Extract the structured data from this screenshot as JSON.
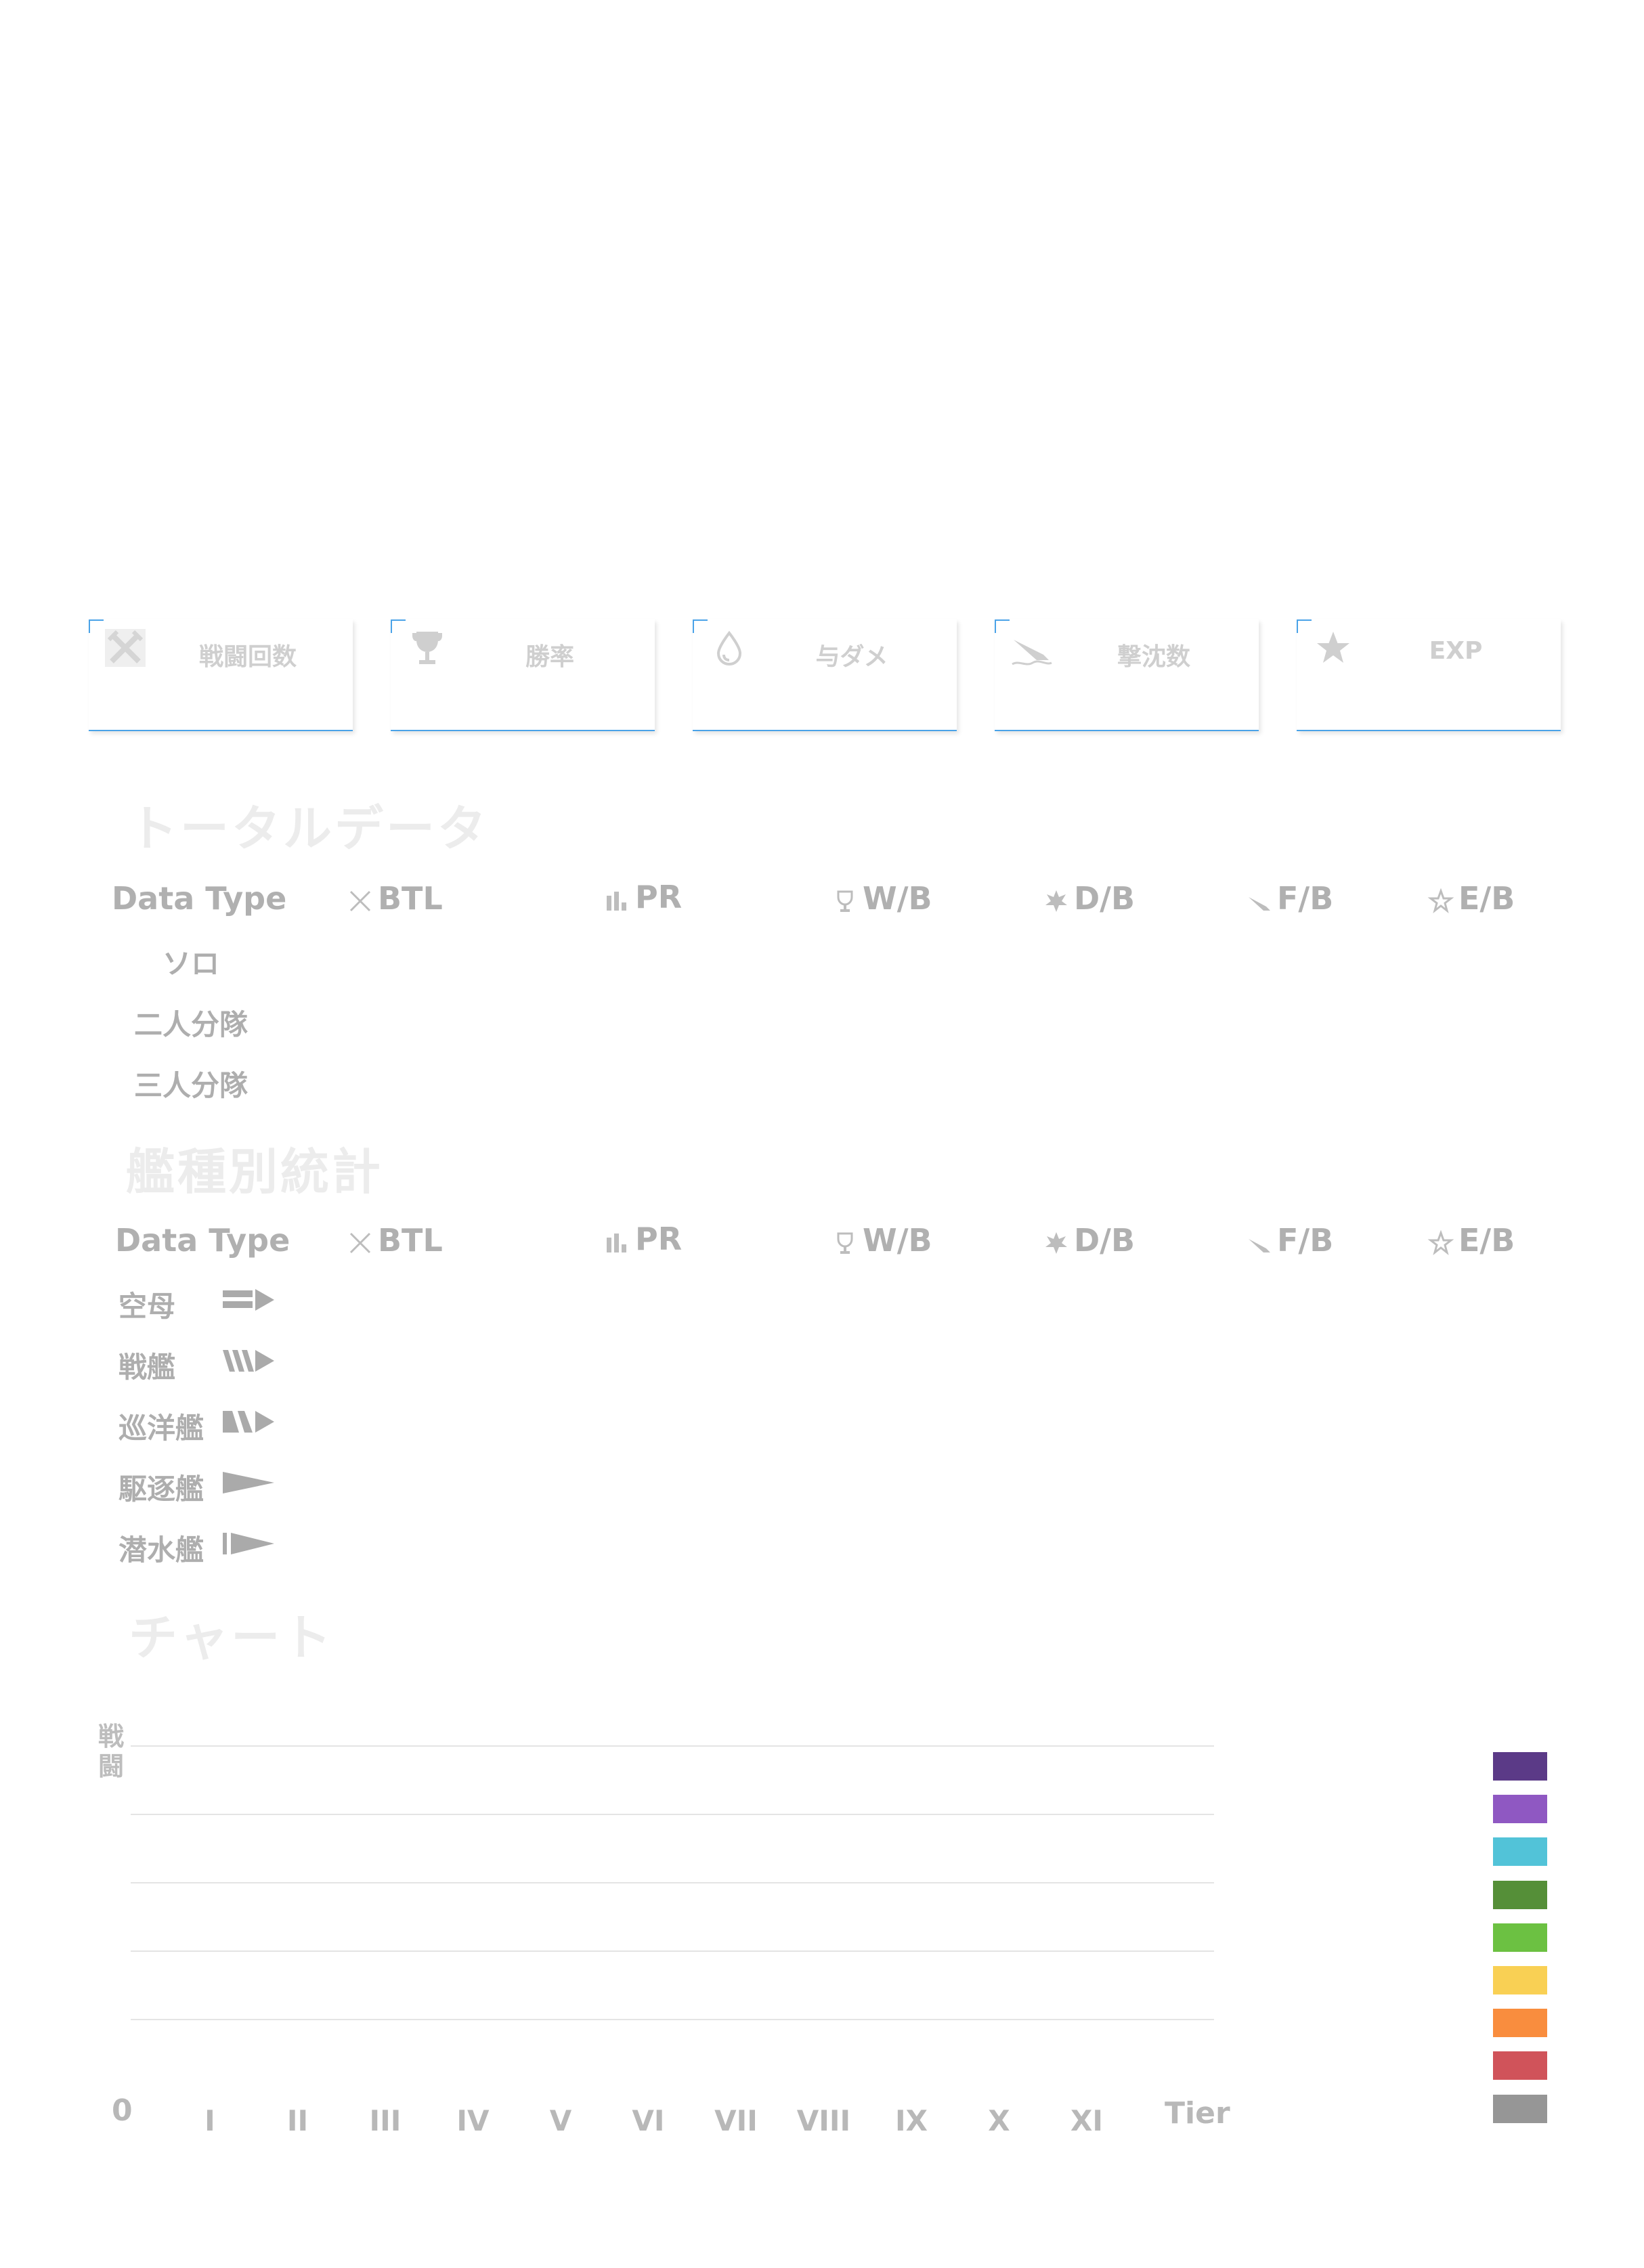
{
  "stat_cards": [
    {
      "label": "戦闘回数",
      "icon": "crossed-swords-icon"
    },
    {
      "label": "勝率",
      "icon": "trophy-icon"
    },
    {
      "label": "与ダメ",
      "icon": "droplet-icon"
    },
    {
      "label": "撃沈数",
      "icon": "sinking-ship-icon"
    },
    {
      "label": "EXP",
      "icon": "star-icon"
    }
  ],
  "total_section": {
    "title": "トータルデータ",
    "headers": [
      "Data Type",
      "BTL",
      "PR",
      "W/B",
      "D/B",
      "F/B",
      "E/B"
    ],
    "rows": [
      "ソロ",
      "二人分隊",
      "三人分隊"
    ]
  },
  "ship_section": {
    "title": "艦種別統計",
    "headers": [
      "Data Type",
      "BTL",
      "PR",
      "W/B",
      "D/B",
      "F/B",
      "E/B"
    ],
    "rows": [
      {
        "label": "空母",
        "icon": "carrier-icon"
      },
      {
        "label": "戦艦",
        "icon": "battleship-icon"
      },
      {
        "label": "巡洋艦",
        "icon": "cruiser-icon"
      },
      {
        "label": "駆逐艦",
        "icon": "destroyer-icon"
      },
      {
        "label": "潜水艦",
        "icon": "submarine-icon"
      }
    ]
  },
  "chart_section": {
    "title": "チャート",
    "chart_data": {
      "type": "bar",
      "ylabel": "戦闘",
      "xlabel": "Tier",
      "y_zero_label": "0",
      "categories": [
        "I",
        "II",
        "III",
        "IV",
        "V",
        "VI",
        "VII",
        "VIII",
        "IX",
        "X",
        "XI"
      ],
      "series": [],
      "legend_colors": [
        "#5b3a87",
        "#8f58c2",
        "#52c3d8",
        "#558f38",
        "#6cc142",
        "#f9d054",
        "#f98d3e",
        "#d0535a",
        "#969696"
      ]
    }
  }
}
